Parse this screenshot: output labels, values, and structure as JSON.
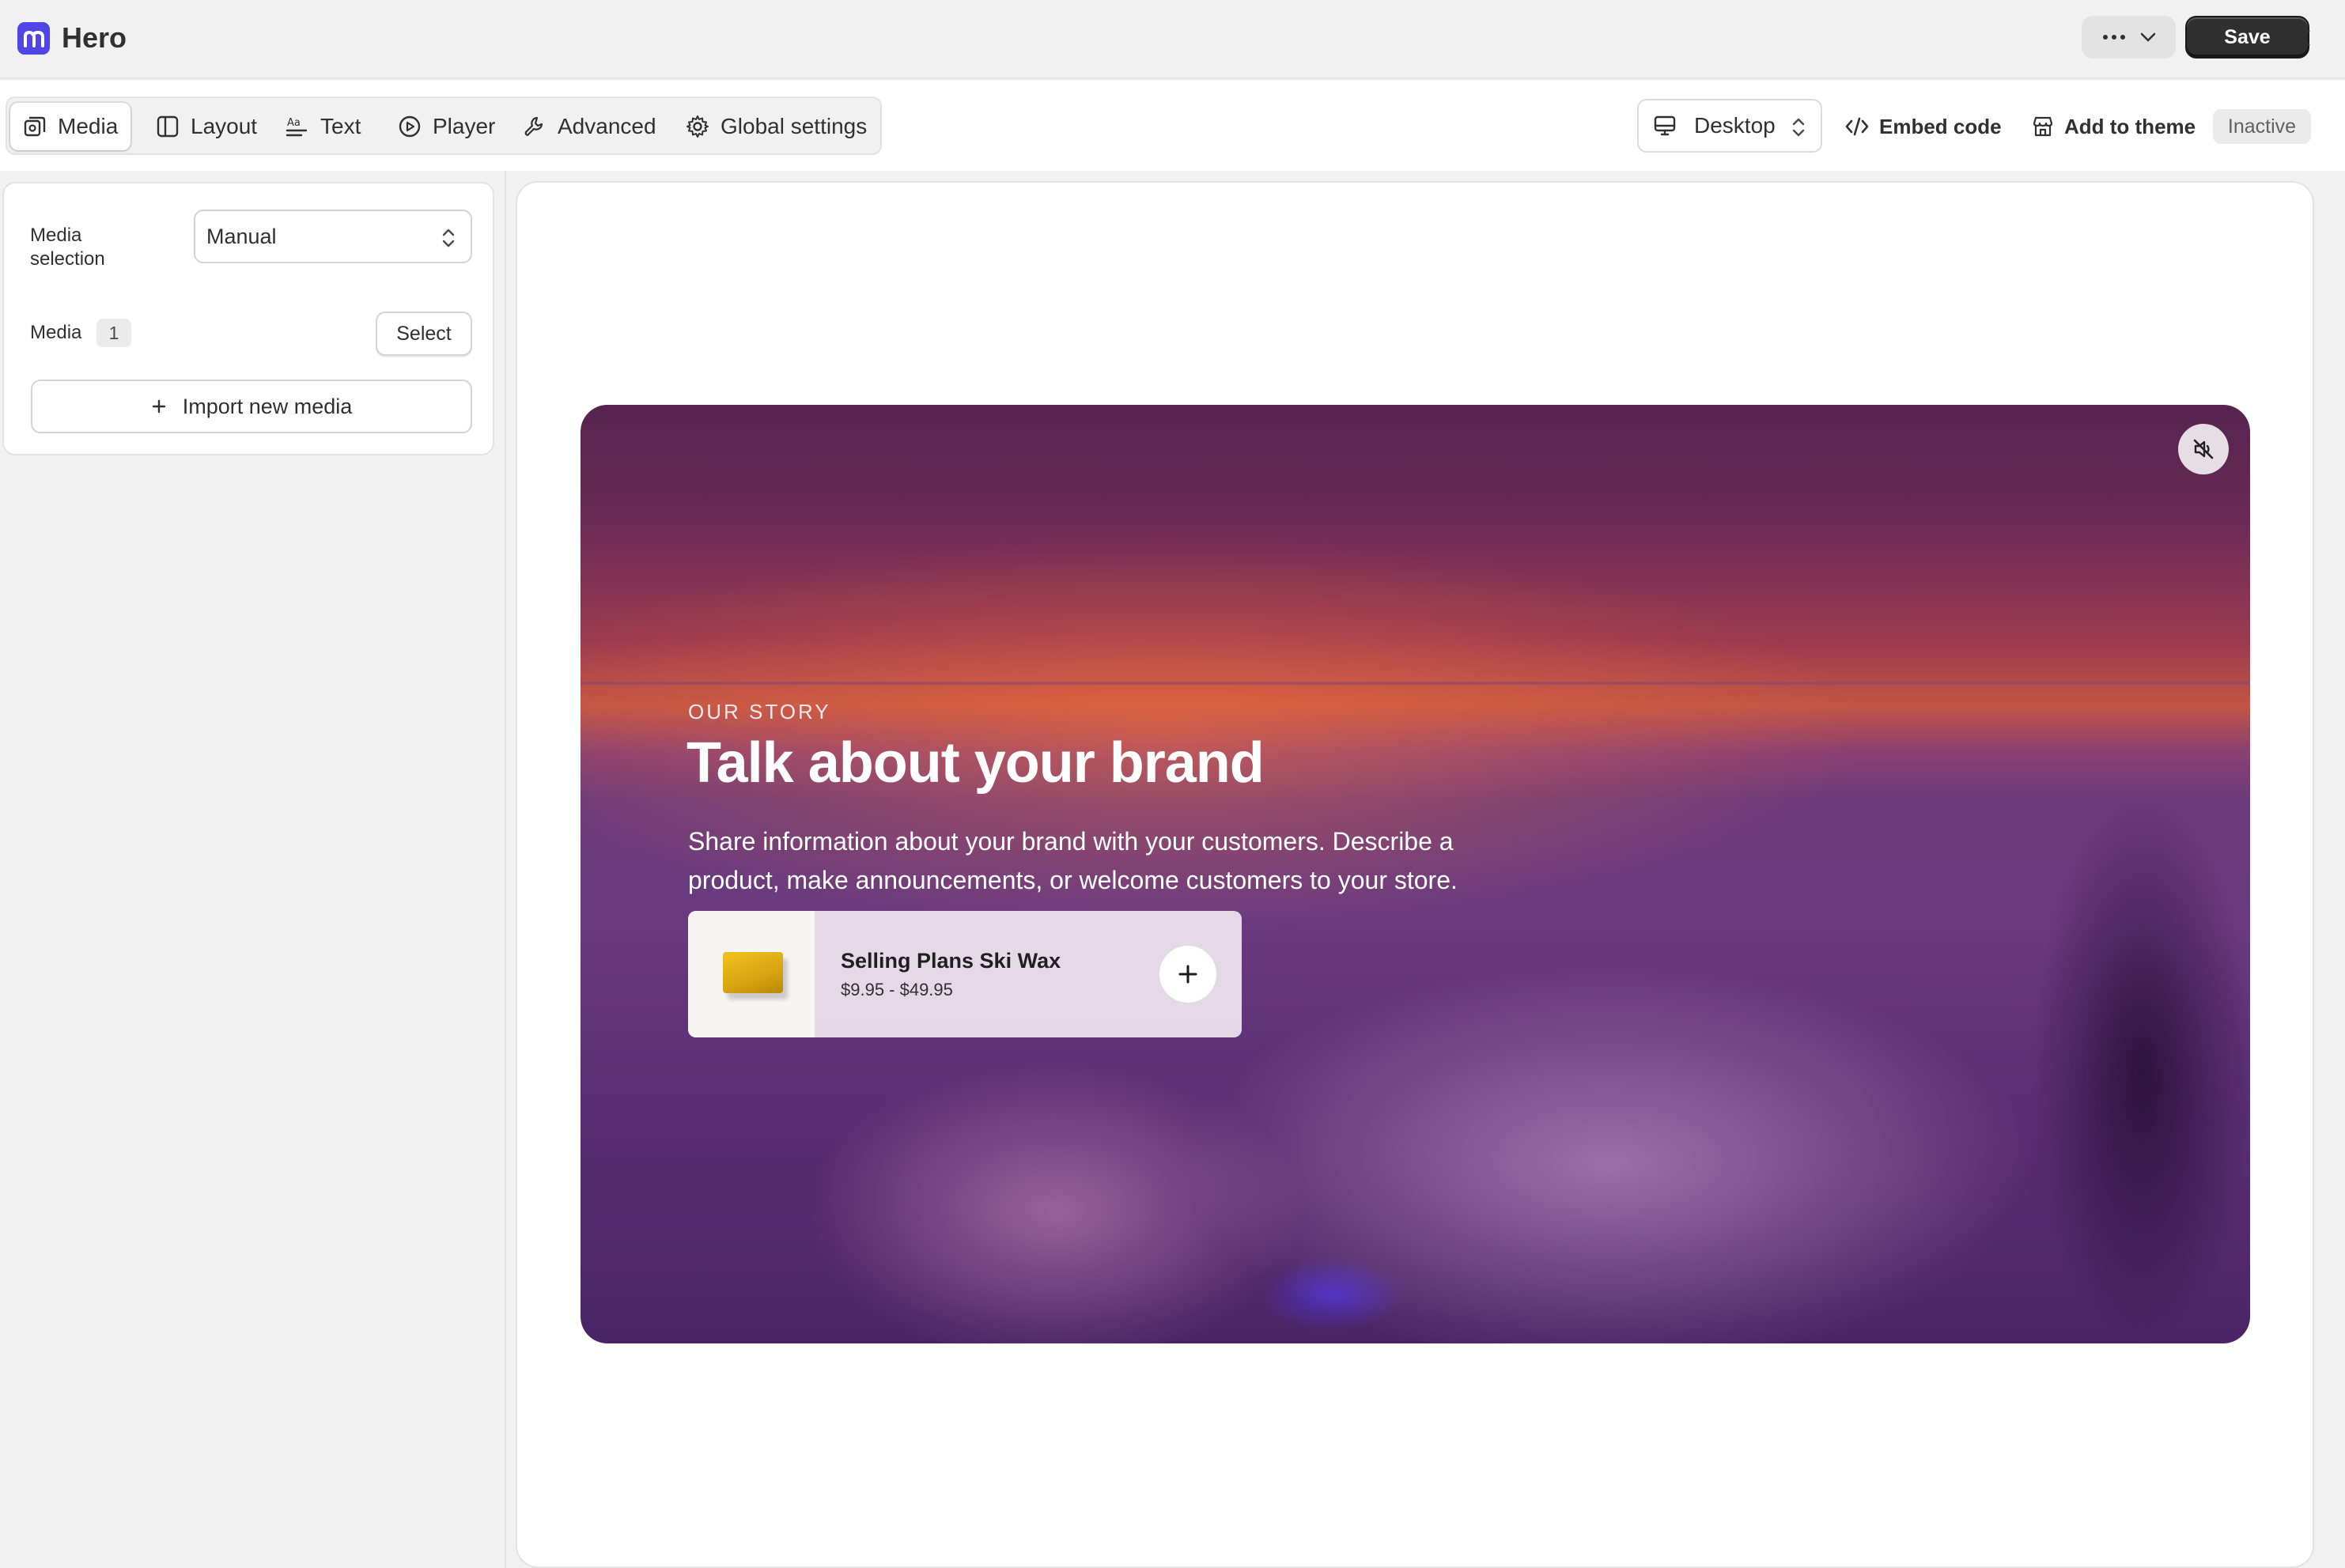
{
  "app": {
    "title": "Hero",
    "logo_letter": "m",
    "brand_color": "#4f46e5",
    "save_label": "Save"
  },
  "toolbar": {
    "tabs": [
      {
        "label": "Media",
        "icon": "media-icon",
        "active": true
      },
      {
        "label": "Layout",
        "icon": "layout-icon",
        "active": false
      },
      {
        "label": "Text",
        "icon": "text-icon",
        "active": false
      },
      {
        "label": "Player",
        "icon": "play-icon",
        "active": false
      },
      {
        "label": "Advanced",
        "icon": "wrench-icon",
        "active": false
      },
      {
        "label": "Global settings",
        "icon": "gear-icon",
        "active": false
      }
    ],
    "device": "Desktop",
    "embed_label": "Embed code",
    "add_theme_label": "Add to theme",
    "status": "Inactive"
  },
  "panel": {
    "media_selection_label_line1": "Media",
    "media_selection_label_line2": "selection",
    "media_selection_value": "Manual",
    "media_label": "Media",
    "media_count": "1",
    "select_label": "Select",
    "import_label": "Import new media"
  },
  "preview": {
    "eyebrow": "OUR STORY",
    "headline": "Talk about your brand",
    "body_line1": "Share information about your brand with your customers. Describe a",
    "body_line2": "product, make announcements, or welcome customers to your store.",
    "product": {
      "name": "Selling Plans Ski Wax",
      "price": "$9.95 - $49.95"
    }
  }
}
